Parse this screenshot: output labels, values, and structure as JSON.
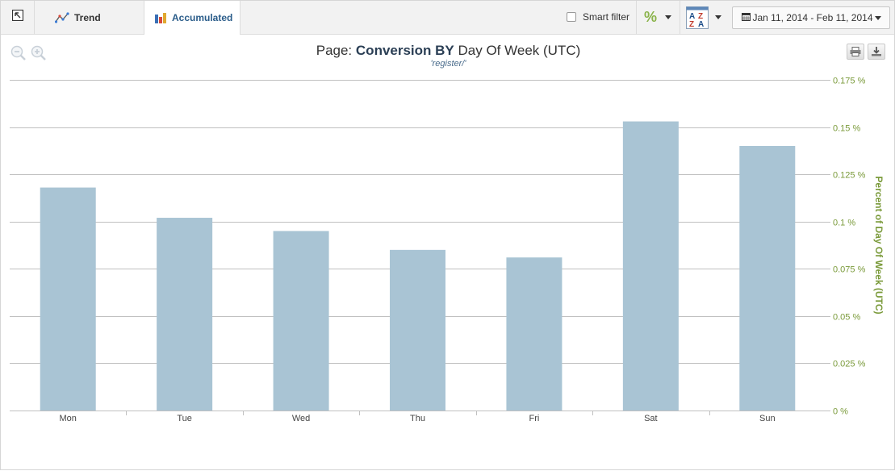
{
  "toolbar": {
    "tabs": [
      {
        "label": "Trend"
      },
      {
        "label": "Accumulated"
      }
    ],
    "smart_filter_label": "Smart filter",
    "percent_symbol": "%",
    "date_range": "Jan 11, 2014 - Feb 11, 2014"
  },
  "title": {
    "prefix": "Page:",
    "metric": "Conversion BY",
    "dimension": "Day Of Week (UTC)",
    "subtitle": "'register/'"
  },
  "colors": {
    "bar": "#a9c4d4",
    "grid": "#c0c0c0",
    "axis_label": "#7a9a3a",
    "accent": "#2b5d8a"
  },
  "chart_data": {
    "type": "bar",
    "title": "Page: Conversion BY Day Of Week (UTC)",
    "subtitle": "'register/'",
    "categories": [
      "Mon",
      "Tue",
      "Wed",
      "Thu",
      "Fri",
      "Sat",
      "Sun"
    ],
    "values": [
      0.118,
      0.102,
      0.095,
      0.085,
      0.081,
      0.153,
      0.14
    ],
    "ylabel": "Percent of Day Of Week (UTC)",
    "ylim": [
      0,
      0.175
    ],
    "yticks": [
      "0 %",
      "0.025 %",
      "0.05 %",
      "0.075 %",
      "0.1 %",
      "0.125 %",
      "0.15 %",
      "0.175 %"
    ],
    "ytick_values": [
      0,
      0.025,
      0.05,
      0.075,
      0.1,
      0.125,
      0.15,
      0.175
    ],
    "y_axis_position": "right",
    "grid": true
  }
}
